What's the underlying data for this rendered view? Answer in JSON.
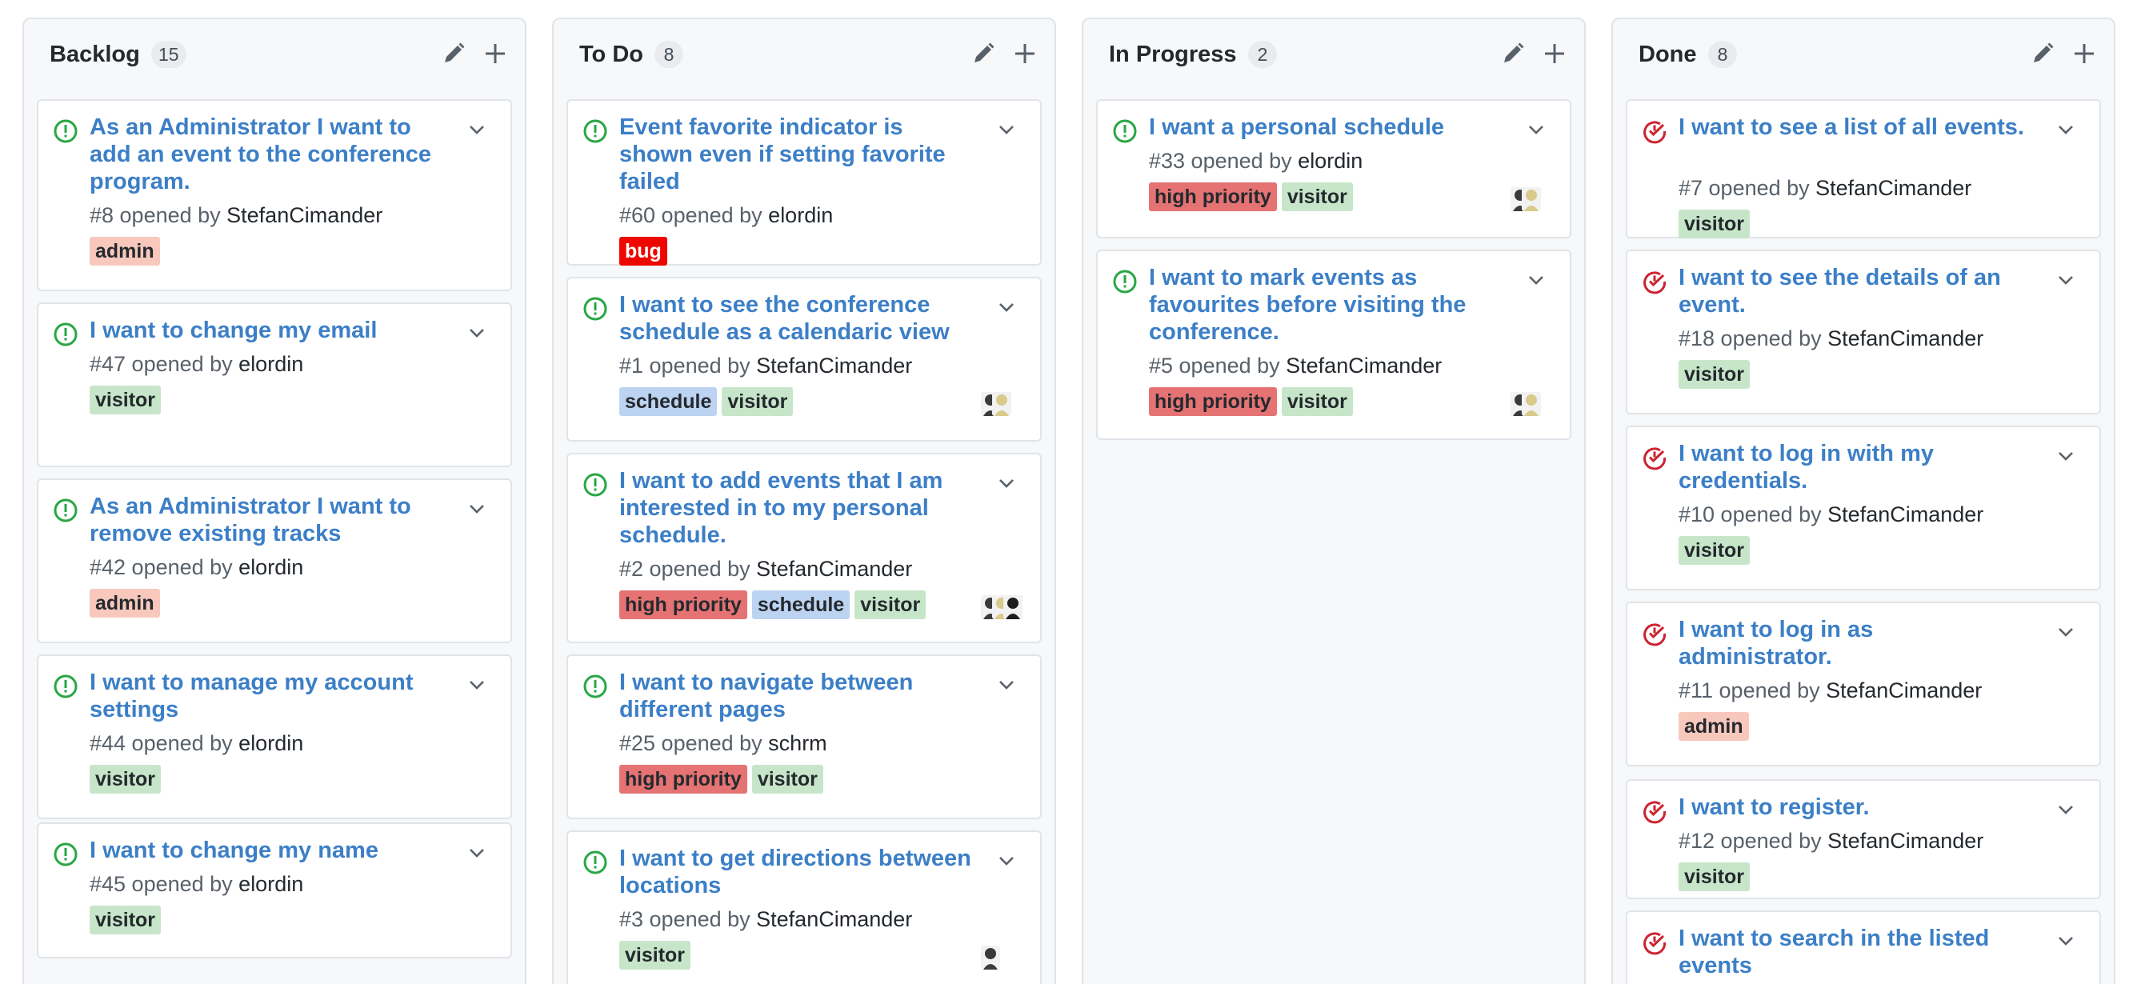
{
  "columns": [
    {
      "title": "Backlog",
      "count": "15",
      "cards": [
        {
          "title": "As an Administrator I want to add an event to the conference program.",
          "meta_prefix": "#8 opened by ",
          "author": "StefanCimander",
          "labels": [
            "admin"
          ],
          "state": "open",
          "avatars": 0
        },
        {
          "title": "I want to change my email",
          "meta_prefix": "#47 opened by ",
          "author": "elordin",
          "labels": [
            "visitor"
          ],
          "state": "open",
          "avatars": 0
        },
        {
          "title": "As an Administrator I want to remove existing tracks",
          "meta_prefix": "#42 opened by ",
          "author": "elordin",
          "labels": [
            "admin"
          ],
          "state": "open",
          "avatars": 0
        },
        {
          "title": "I want to manage my account settings",
          "meta_prefix": "#44 opened by ",
          "author": "elordin",
          "labels": [
            "visitor"
          ],
          "state": "open",
          "avatars": 0
        },
        {
          "title": "I want to change my name",
          "meta_prefix": "#45 opened by ",
          "author": "elordin",
          "labels": [
            "visitor"
          ],
          "state": "open",
          "avatars": 0
        }
      ]
    },
    {
      "title": "To Do",
      "count": "8",
      "cards": [
        {
          "title": "Event favorite indicator is shown even if setting favorite failed",
          "meta_prefix": "#60 opened by ",
          "author": "elordin",
          "labels": [
            "bug"
          ],
          "state": "open",
          "avatars": 0
        },
        {
          "title": "I want to see the conference schedule as a calendaric view",
          "meta_prefix": "#1 opened by ",
          "author": "StefanCimander",
          "labels": [
            "schedule",
            "visitor"
          ],
          "state": "open",
          "avatars": 2
        },
        {
          "title": "I want to add events that I am interested in to my personal schedule.",
          "meta_prefix": "#2 opened by ",
          "author": "StefanCimander",
          "labels": [
            "high priority",
            "schedule",
            "visitor"
          ],
          "state": "open",
          "avatars": 3
        },
        {
          "title": "I want to navigate between different pages",
          "meta_prefix": "#25 opened by ",
          "author": "schrm",
          "labels": [
            "high priority",
            "visitor"
          ],
          "state": "open",
          "avatars": 0
        },
        {
          "title": "I want to get directions between locations",
          "meta_prefix": "#3 opened by ",
          "author": "StefanCimander",
          "labels": [
            "visitor"
          ],
          "state": "open",
          "avatars": 1
        }
      ]
    },
    {
      "title": "In Progress",
      "count": "2",
      "cards": [
        {
          "title": "I want a personal schedule",
          "meta_prefix": "#33 opened by ",
          "author": "elordin",
          "labels": [
            "high priority",
            "visitor"
          ],
          "state": "open",
          "avatars": 2
        },
        {
          "title": "I want to mark events as favourites before visiting the conference.",
          "meta_prefix": "#5 opened by ",
          "author": "StefanCimander",
          "labels": [
            "high priority",
            "visitor"
          ],
          "state": "open",
          "avatars": 2
        }
      ]
    },
    {
      "title": "Done",
      "count": "8",
      "cards": [
        {
          "title": "I want to see a list of all events.",
          "meta_prefix": "#7 opened by ",
          "author": "StefanCimander",
          "labels": [
            "visitor"
          ],
          "state": "closed",
          "avatars": 0
        },
        {
          "title": "I want to see the details of an event.",
          "meta_prefix": "#18 opened by ",
          "author": "StefanCimander",
          "labels": [
            "visitor"
          ],
          "state": "closed",
          "avatars": 0
        },
        {
          "title": "I want to log in with my credentials.",
          "meta_prefix": "#10 opened by ",
          "author": "StefanCimander",
          "labels": [
            "visitor"
          ],
          "state": "closed",
          "avatars": 0
        },
        {
          "title": "I want to log in as administrator.",
          "meta_prefix": "#11 opened by ",
          "author": "StefanCimander",
          "labels": [
            "admin"
          ],
          "state": "closed",
          "avatars": 0
        },
        {
          "title": "I want to register.",
          "meta_prefix": "#12 opened by ",
          "author": "StefanCimander",
          "labels": [
            "visitor"
          ],
          "state": "closed",
          "avatars": 0
        },
        {
          "title": "I want to search in the listed events",
          "meta_prefix": "",
          "author": "",
          "labels": [],
          "state": "closed",
          "avatars": 0
        }
      ]
    }
  ],
  "colors": {
    "open_icon": "#28a745",
    "closed_icon": "#cb2431",
    "title_link": "#3c7fc7",
    "label_admin": "#f8c8bd",
    "label_visitor": "#c7e6c9",
    "label_high_priority": "#e57373",
    "label_schedule": "#bcd3f1",
    "label_bug": "#ee0701"
  }
}
